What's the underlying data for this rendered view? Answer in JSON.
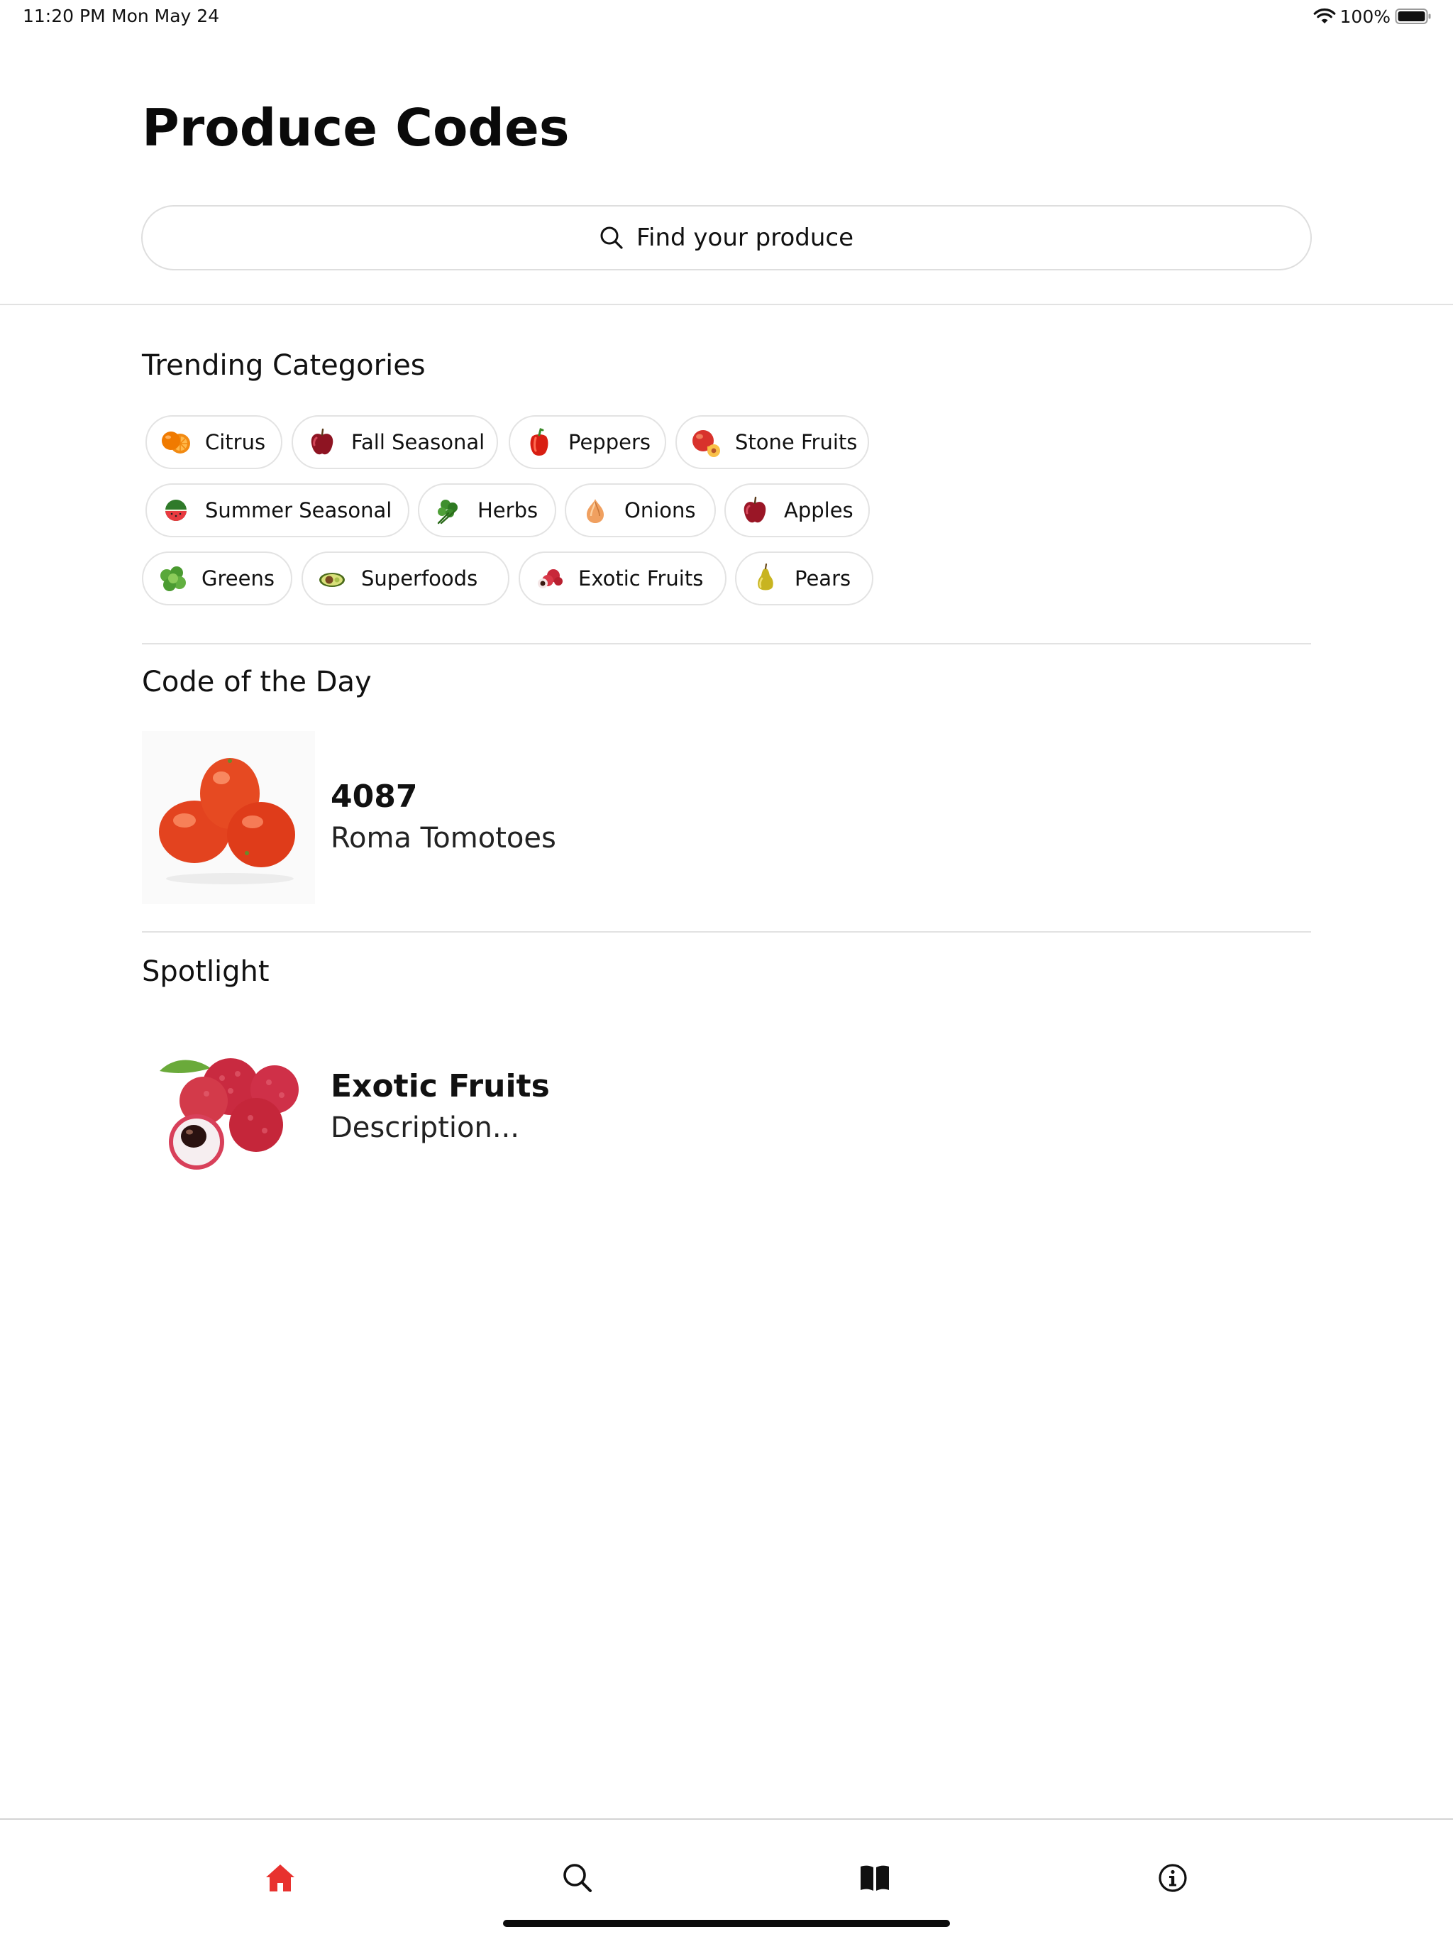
{
  "status_bar": {
    "time": "11:20 PM",
    "date": "Mon May 24",
    "battery_percent": "100%",
    "icons": [
      "wifi-icon",
      "battery-icon"
    ]
  },
  "header": {
    "title": "Produce Codes"
  },
  "search": {
    "placeholder": "Find your produce",
    "icon": "search-icon"
  },
  "trending": {
    "heading": "Trending Categories",
    "chips": [
      {
        "label": "Citrus",
        "icon": "orange-icon"
      },
      {
        "label": "Fall Seasonal",
        "icon": "apple-icon"
      },
      {
        "label": "Peppers",
        "icon": "pepper-icon"
      },
      {
        "label": "Stone Fruits",
        "icon": "peach-icon"
      },
      {
        "label": "Summer Seasonal",
        "icon": "watermelon-icon"
      },
      {
        "label": "Herbs",
        "icon": "herbs-icon"
      },
      {
        "label": "Onions",
        "icon": "onion-icon"
      },
      {
        "label": "Apples",
        "icon": "apple-icon"
      },
      {
        "label": "Greens",
        "icon": "lettuce-icon"
      },
      {
        "label": "Superfoods",
        "icon": "avocado-icon"
      },
      {
        "label": "Exotic Fruits",
        "icon": "lychee-icon"
      },
      {
        "label": "Pears",
        "icon": "pear-icon"
      }
    ]
  },
  "code_of_the_day": {
    "heading": "Code of the Day",
    "code": "4087",
    "name": "Roma Tomotoes",
    "image": "roma-tomatoes-image"
  },
  "spotlight": {
    "heading": "Spotlight",
    "title": "Exotic Fruits",
    "description": "Description...",
    "image": "lychee-image"
  },
  "tab_bar": {
    "accent_color": "#e8322f",
    "inactive_color": "#111111",
    "tabs": [
      {
        "name": "home",
        "icon": "home-icon",
        "active": true
      },
      {
        "name": "search",
        "icon": "search-icon",
        "active": false
      },
      {
        "name": "library",
        "icon": "book-icon",
        "active": false
      },
      {
        "name": "info",
        "icon": "info-icon",
        "active": false
      }
    ]
  }
}
